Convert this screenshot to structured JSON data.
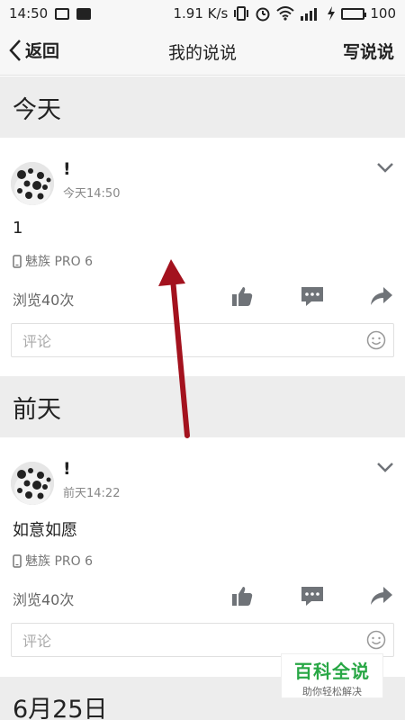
{
  "status_bar": {
    "time": "14:50",
    "speed": "1.91 K/s",
    "battery": "100"
  },
  "nav": {
    "back_label": "返回",
    "title": "我的说说",
    "write_label": "写说说"
  },
  "sections": [
    {
      "header": "今天",
      "post": {
        "name": "!",
        "time": "今天14:50",
        "content": "1",
        "device": "魅族 PRO 6",
        "views": "浏览40次",
        "comment_placeholder": "评论"
      }
    },
    {
      "header": "前天",
      "post": {
        "name": "!",
        "time": "前天14:22",
        "content": "如意如愿",
        "device": "魅族 PRO 6",
        "views": "浏览40次",
        "comment_placeholder": "评论"
      }
    },
    {
      "header": "6月25日"
    }
  ],
  "watermark": {
    "title": "百科全说",
    "subtitle": "助你轻松解决"
  },
  "colors": {
    "arrow": "#a3121e",
    "icon_gray": "#6f7378",
    "section_bg": "#ededed"
  }
}
